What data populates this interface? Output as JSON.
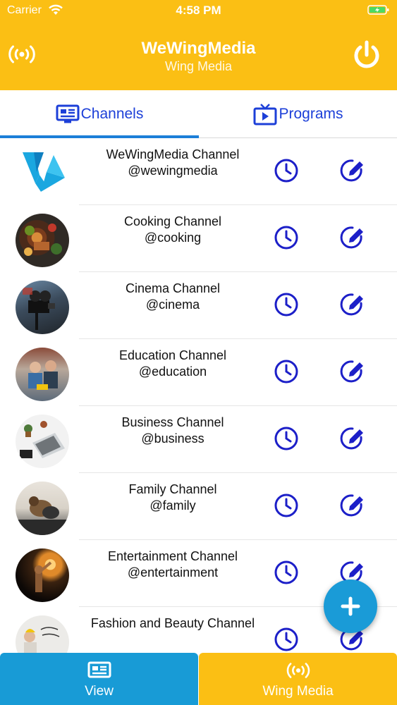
{
  "status_bar": {
    "carrier": "Carrier",
    "time": "4:58 PM"
  },
  "header": {
    "title": "WeWingMedia",
    "subtitle": "Wing Media"
  },
  "tabs": [
    {
      "label": "Channels",
      "icon": "newspaper-icon",
      "active": true
    },
    {
      "label": "Programs",
      "icon": "tv-play-icon",
      "active": false
    }
  ],
  "channels": [
    {
      "name": "WeWingMedia Channel",
      "handle": "@wewingmedia"
    },
    {
      "name": "Cooking Channel",
      "handle": "@cooking"
    },
    {
      "name": "Cinema Channel",
      "handle": "@cinema"
    },
    {
      "name": "Education Channel",
      "handle": "@education"
    },
    {
      "name": "Business Channel",
      "handle": "@business"
    },
    {
      "name": "Family Channel",
      "handle": "@family"
    },
    {
      "name": "Entertainment Channel",
      "handle": "@entertainment"
    },
    {
      "name": "Fashion and Beauty Channel",
      "handle": ""
    }
  ],
  "bottom_nav": [
    {
      "label": "View",
      "icon": "newspaper-icon"
    },
    {
      "label": "Wing Media",
      "icon": "broadcast-icon"
    }
  ],
  "colors": {
    "header": "#fbbf14",
    "accent_blue": "#1c3fd8",
    "fab": "#1a9bd7",
    "bottom_view": "#189bd6"
  }
}
